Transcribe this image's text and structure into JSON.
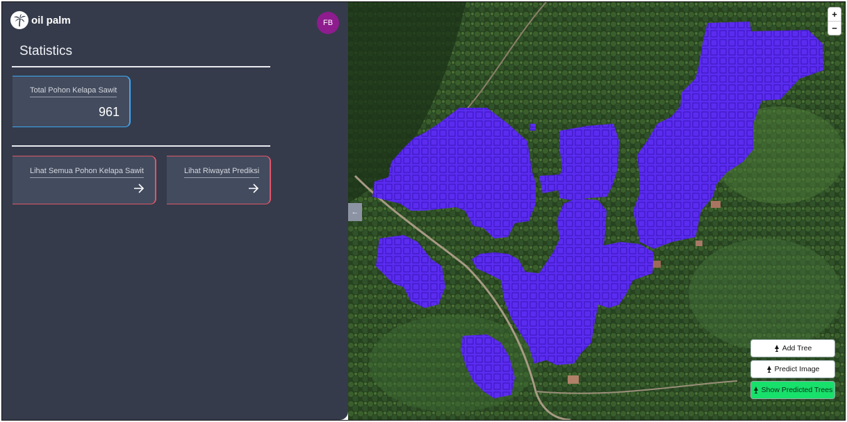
{
  "brand": {
    "name": "oil palm",
    "logo_icon": "palm-tree-icon"
  },
  "user": {
    "initials": "FB",
    "avatar_color": "#8e1c8e"
  },
  "statistics": {
    "title": "Statistics",
    "total_card": {
      "label": "Total Pohon Kelapa Sawit",
      "value": "961",
      "accent": "#3fa9f5"
    }
  },
  "links": [
    {
      "label": "Lihat Semua Pohon Kelapa Sawit",
      "icon": "arrow-right-icon",
      "accent": "#e0566a"
    },
    {
      "label": "Lihat Riwayat Prediksi",
      "icon": "arrow-right-icon",
      "accent": "#e0566a"
    }
  ],
  "map": {
    "zoom_in": "+",
    "zoom_out": "−",
    "collapse_icon": "←",
    "detection_color": "#5b2cf0",
    "buttons": {
      "add_tree": "Add Tree",
      "predict_image": "Predict Image",
      "show_predicted": "Show Predicted Trees"
    }
  }
}
